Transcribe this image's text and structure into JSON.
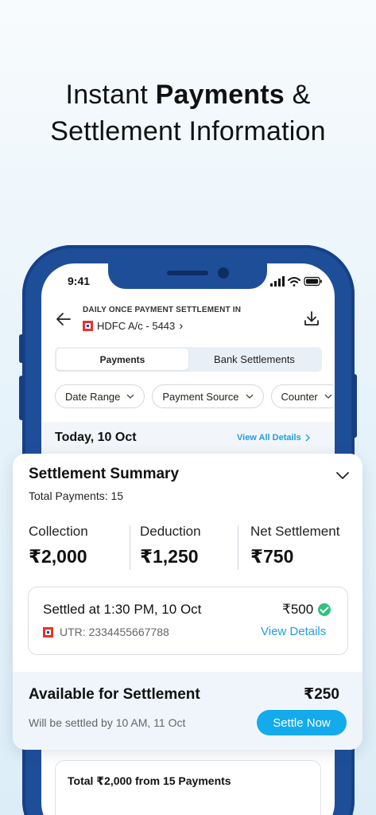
{
  "headline": {
    "prefix": "Instant ",
    "bold": "Payments",
    "suffix": " &",
    "line2": "Settlement Information"
  },
  "status_bar": {
    "time": "9:41"
  },
  "app_bar": {
    "title": "DAILY ONCE PAYMENT SETTLEMENT IN",
    "bank_account": "HDFC A/c - 5443",
    "chevron": "›"
  },
  "tabs": [
    {
      "label": "Payments",
      "active": true
    },
    {
      "label": "Bank Settlements",
      "active": false
    }
  ],
  "filters": [
    {
      "label": "Date Range"
    },
    {
      "label": "Payment Source"
    },
    {
      "label": "Counter"
    }
  ],
  "day_header": {
    "date": "Today, 10 Oct",
    "link": "View All Details"
  },
  "summary": {
    "title": "Settlement Summary",
    "total_payments": "Total Payments: 15",
    "metrics": [
      {
        "label": "Collection",
        "value": "₹2,000"
      },
      {
        "label": "Deduction",
        "value": "₹1,250"
      },
      {
        "label": "Net Settlement",
        "value": "₹750"
      }
    ],
    "settled": {
      "text": "Settled at 1:30 PM, 10 Oct",
      "amount": "₹500",
      "utr": "UTR: 2334455667788",
      "link": "View Details"
    },
    "available": {
      "title": "Available for Settlement",
      "amount": "₹250",
      "subtitle": "Will be settled by 10 AM, 11 Oct",
      "button": "Settle Now"
    }
  },
  "bottom_card": {
    "title": "Total ₹2,000 from 15 Payments"
  },
  "colors": {
    "accent": "#14abec",
    "phone": "#1f4e99",
    "success": "#2ec27e",
    "bank_logo": "#e5322d"
  }
}
